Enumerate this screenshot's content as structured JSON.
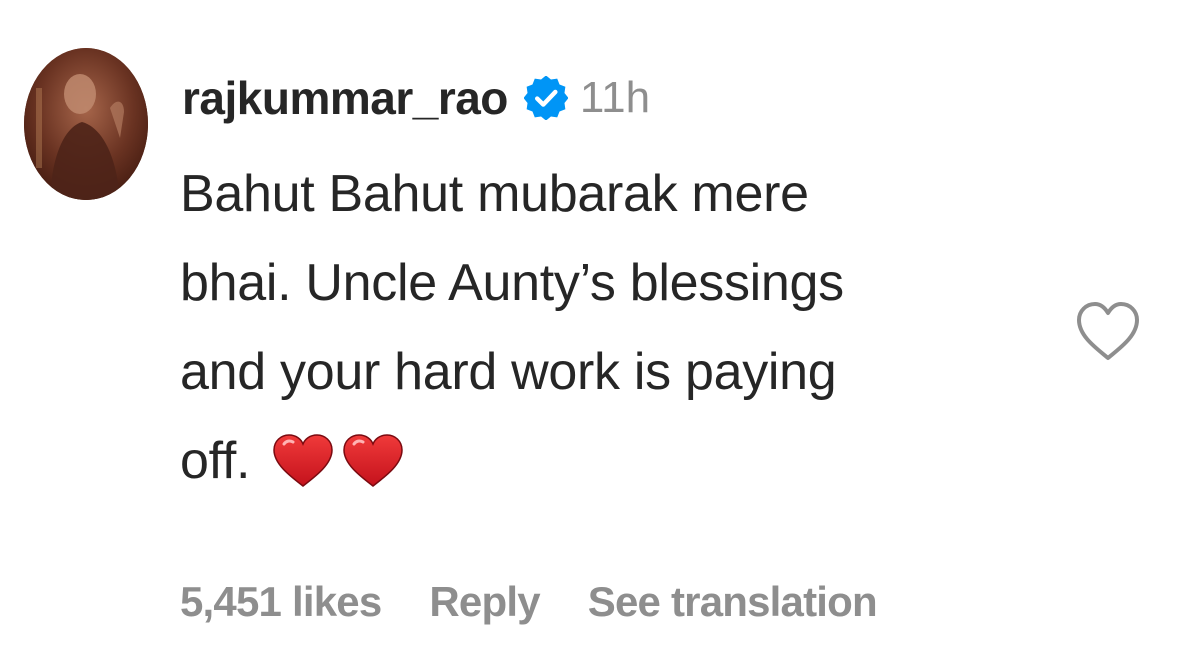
{
  "comment": {
    "username": "rajkummar_rao",
    "verified_icon": "verified-badge-icon",
    "timestamp": "11h",
    "text_lines": [
      "Bahut Bahut mubarak mere",
      "bhai. Uncle Aunty’s blessings",
      "and your hard work is paying",
      "off."
    ],
    "emojis": [
      "red-heart-emoji",
      "red-heart-emoji"
    ],
    "likes": "5,451 likes",
    "reply_label": "Reply",
    "translation_label": "See translation",
    "like_icon": "heart-outline-icon"
  },
  "colors": {
    "text": "#262626",
    "muted": "#8e8e8e",
    "verified_blue": "#0095f6",
    "heart_red": "#e0202f"
  }
}
